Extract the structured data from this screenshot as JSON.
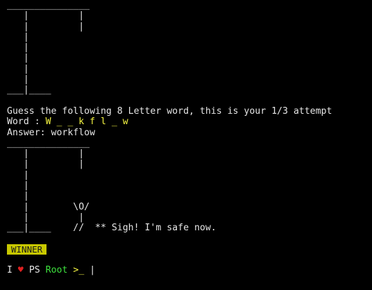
{
  "terminal": {
    "gallows_1": [
      "_______________",
      "   |         |",
      "   |         |",
      "   |",
      "   |",
      "   |",
      "   |",
      "   |",
      "___|____",
      ""
    ],
    "guess_prompt": "Guess the following 8 Letter word, this is your 1/3 attempt",
    "word_label": "Word : ",
    "word_value": "W _ _ k f l _ w",
    "answer_label": "Answer: ",
    "answer_value": "workflow",
    "gallows_2": [
      "_______________",
      "   |         |",
      "   |         |",
      "   |",
      "   |",
      "   |",
      "   |        \\O/",
      "   |         |",
      "___|____    //  ** Sigh! I'm safe now.",
      ""
    ],
    "winner_badge": "WINNER",
    "prompt": {
      "i_text": "I",
      "heart": "♥",
      "ps_text": "PS",
      "root_text": "Root",
      "symbol": ">_",
      "cursor": "|"
    }
  },
  "colors": {
    "background": "#000000",
    "text": "#e6e6e6",
    "highlight_yellow": "#f5f542",
    "badge_bg": "#c8c800",
    "heart_red": "#e02020",
    "root_green": "#3ee23e"
  }
}
